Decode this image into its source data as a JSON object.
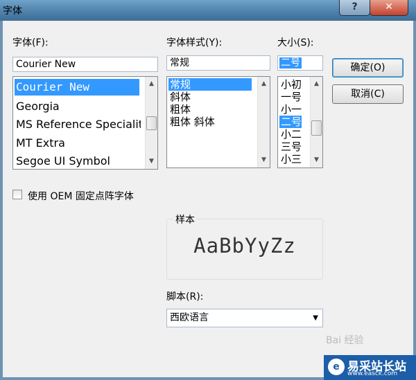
{
  "window": {
    "title": "字体",
    "help_label": "?",
    "close_label": "✕"
  },
  "font": {
    "label": "字体(F):",
    "value": "Courier New",
    "items": [
      "Courier New",
      "Georgia",
      "MS Reference Speciality",
      "MT Extra",
      "Segoe UI Symbol"
    ]
  },
  "style": {
    "label": "字体样式(Y):",
    "value": "常规",
    "items": [
      "常规",
      "斜体",
      "粗体",
      "粗体 斜体"
    ]
  },
  "size": {
    "label": "大小(S):",
    "value": "二号",
    "items": [
      "小初",
      "一号",
      "小一",
      "二号",
      "小二",
      "三号",
      "小三"
    ]
  },
  "buttons": {
    "ok": "确定(O)",
    "cancel": "取消(C)"
  },
  "oem_checkbox": {
    "label": "使用 OEM 固定点阵字体",
    "checked": false
  },
  "sample": {
    "label": "样本",
    "text": "AaBbYyZz"
  },
  "script": {
    "label": "脚本(R):",
    "value": "西欧语言"
  },
  "watermark": "Bai 经验",
  "brand": {
    "name": "易采站长站",
    "url": "www.easck.com",
    "logo": "e"
  }
}
